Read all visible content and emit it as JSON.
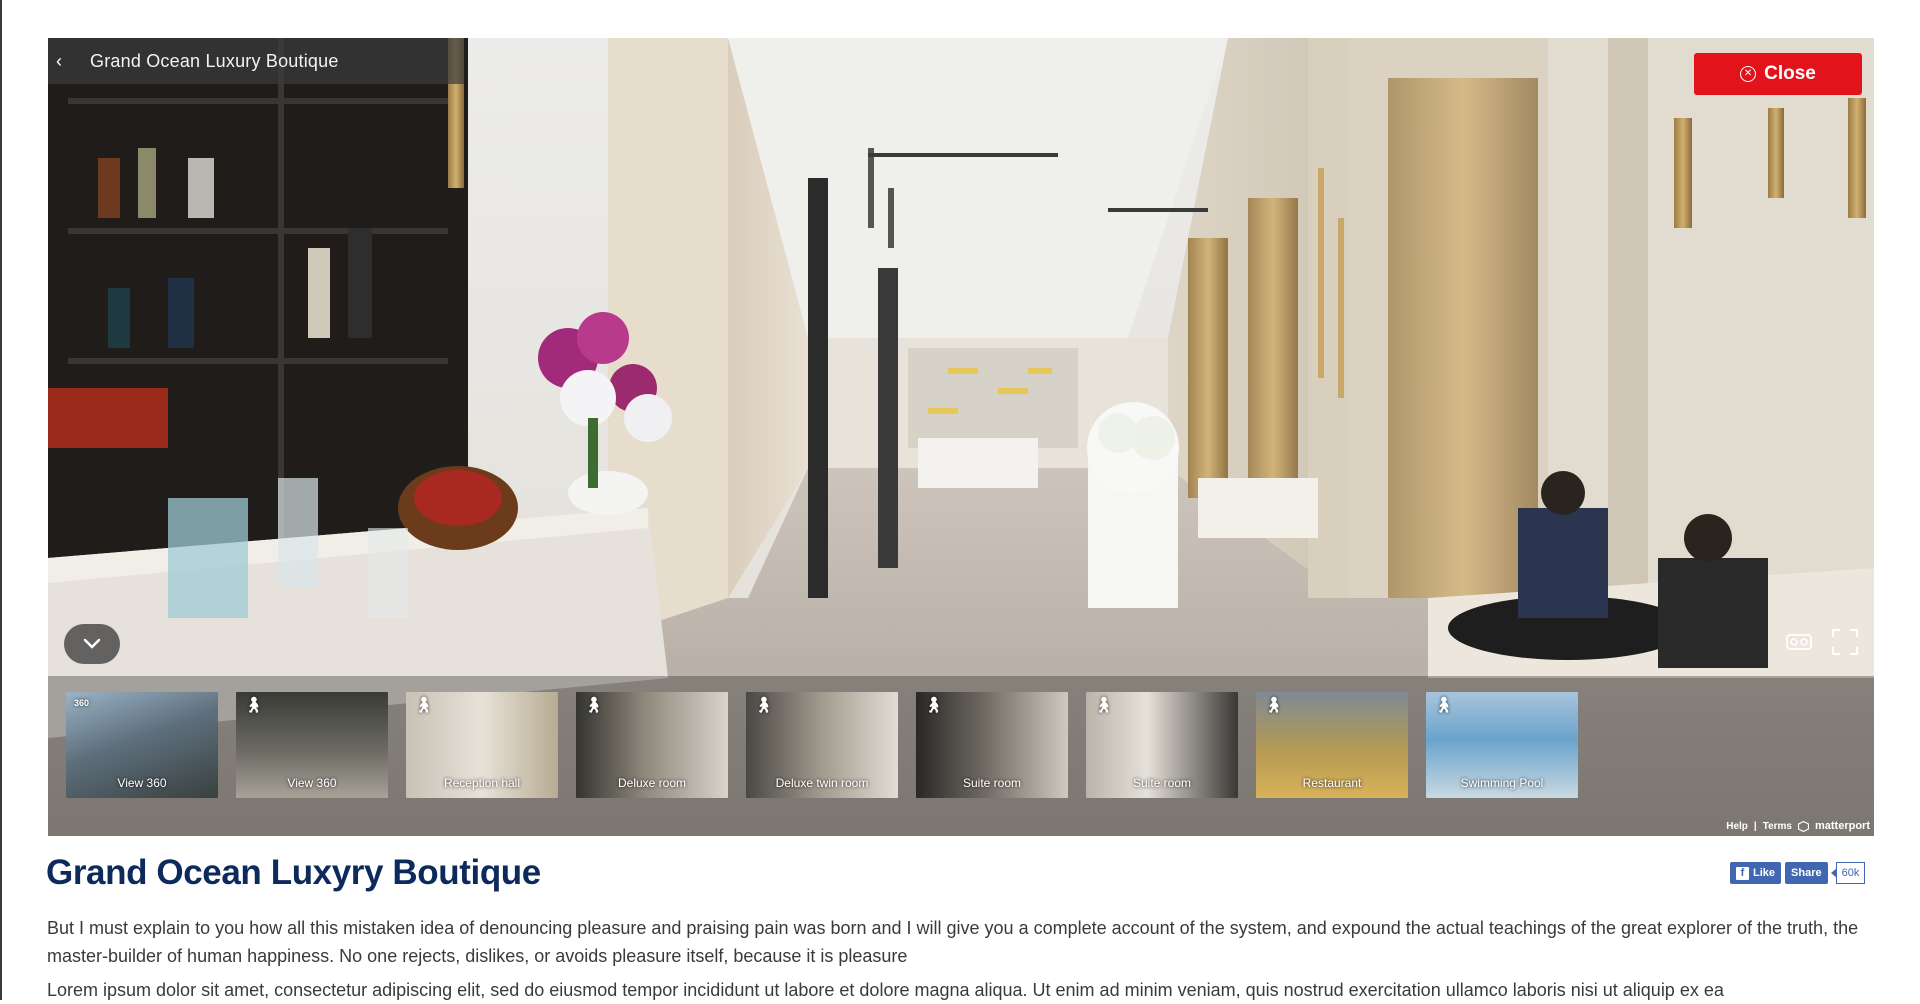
{
  "viewer": {
    "tour_title": "Grand Ocean Luxury Boutique",
    "close_label": "Close",
    "thumbnails": [
      {
        "label": "View 360",
        "tag": "360"
      },
      {
        "label": "View 360",
        "tag": "walk"
      },
      {
        "label": "Reception hall",
        "tag": "walk"
      },
      {
        "label": "Deluxe room",
        "tag": "walk"
      },
      {
        "label": "Deluxe twin room",
        "tag": "walk"
      },
      {
        "label": "Suite room",
        "tag": "walk"
      },
      {
        "label": "Suite room",
        "tag": "walk"
      },
      {
        "label": "Restaurant",
        "tag": "walk"
      },
      {
        "label": "Swimming Pool",
        "tag": "walk"
      }
    ],
    "footer": {
      "help": "Help",
      "separator": "|",
      "terms": "Terms",
      "brand": "matterport"
    }
  },
  "page": {
    "title": "Grand Ocean Luxyry Boutique",
    "paragraph_1": "But I must explain to you how all this mistaken idea of denouncing pleasure and praising pain was born and I will give you a complete account of the system, and expound the actual teachings of the great explorer of the truth, the master-builder of human happiness. No one rejects, dislikes, or avoids pleasure itself, because it is pleasure",
    "paragraph_2": "Lorem ipsum dolor sit amet, consectetur adipiscing elit, sed do eiusmod tempor incididunt ut labore et dolore magna aliqua. Ut enim ad minim veniam, quis nostrud exercitation ullamco laboris nisi ut aliquip ex ea"
  },
  "social": {
    "like_label": "Like",
    "share_label": "Share",
    "count": "60k"
  },
  "colors": {
    "close_red": "#e3131b",
    "title_navy": "#0d2a5c",
    "facebook_blue": "#4267b2"
  },
  "icons": [
    "back-arrow-icon",
    "close-circle-icon",
    "chevron-down-icon",
    "vr-headset-icon",
    "fullscreen-icon",
    "walk-icon",
    "matterport-logo-icon",
    "facebook-icon"
  ]
}
